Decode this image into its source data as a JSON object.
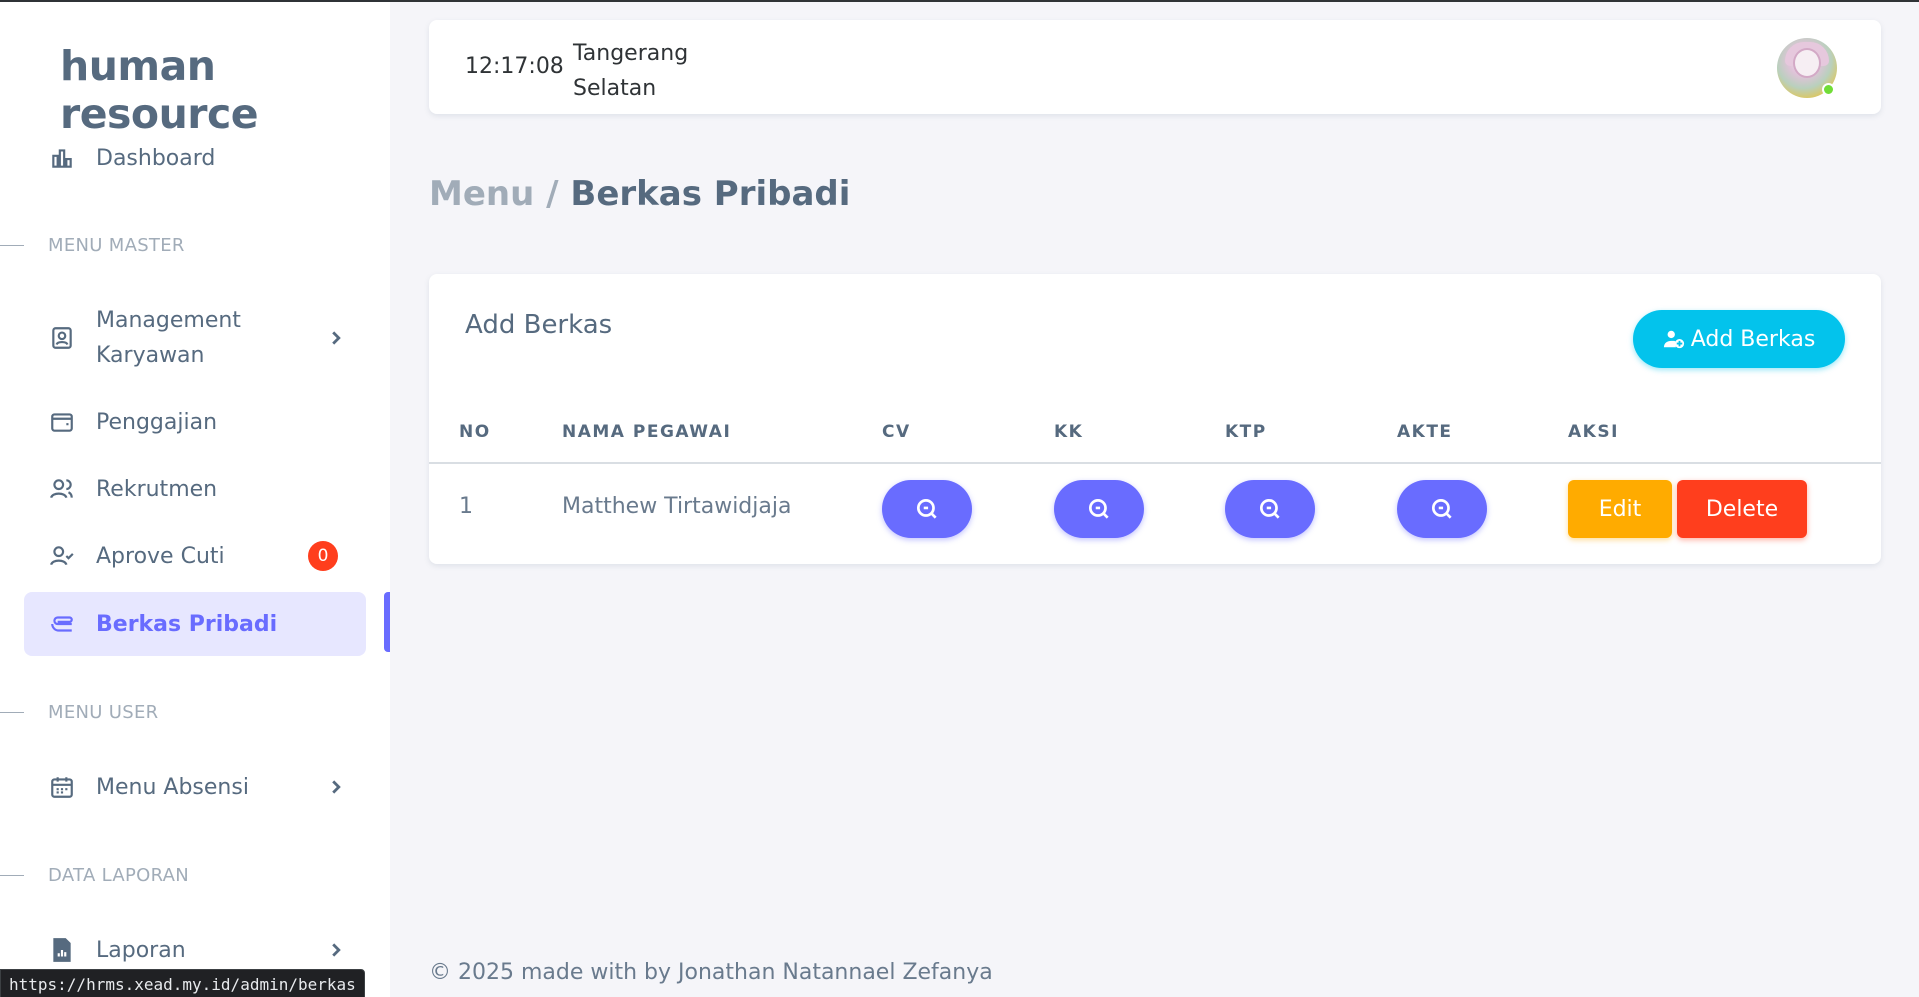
{
  "brand": "human resource",
  "sidebar": {
    "dashboard": "Dashboard",
    "sections": {
      "master": "MENU MASTER",
      "user": "MENU USER",
      "laporan": "DATA LAPORAN"
    },
    "items": {
      "management_line1": "Management",
      "management_line2": "Karyawan",
      "penggajian": "Penggajian",
      "rekrutmen": "Rekrutmen",
      "aprove_cuti": "Aprove Cuti",
      "aprove_cuti_badge": "0",
      "berkas_pribadi": "Berkas Pribadi",
      "menu_absensi": "Menu Absensi",
      "laporan": "Laporan"
    }
  },
  "navbar": {
    "time": "12:17:08",
    "location_line1": "Tangerang",
    "location_line2": "Selatan"
  },
  "page": {
    "crumb": "Menu /",
    "title": "Berkas Pribadi"
  },
  "card": {
    "title": "Add Berkas",
    "add_button": "Add Berkas",
    "columns": [
      "NO",
      "NAMA PEGAWAI",
      "CV",
      "KK",
      "KTP",
      "AKTE",
      "AKSI"
    ],
    "rows": [
      {
        "no": "1",
        "nama": "Matthew Tirtawidjaja",
        "edit": "Edit",
        "delete": "Delete"
      }
    ]
  },
  "footer": "© 2025 made with by Jonathan Natannael Zefanya",
  "statusbar": "https://hrms.xead.my.id/admin/berkas",
  "colors": {
    "primary": "#696cff",
    "info": "#03c3ec",
    "warning": "#ffab00",
    "danger": "#ff3e1d"
  }
}
